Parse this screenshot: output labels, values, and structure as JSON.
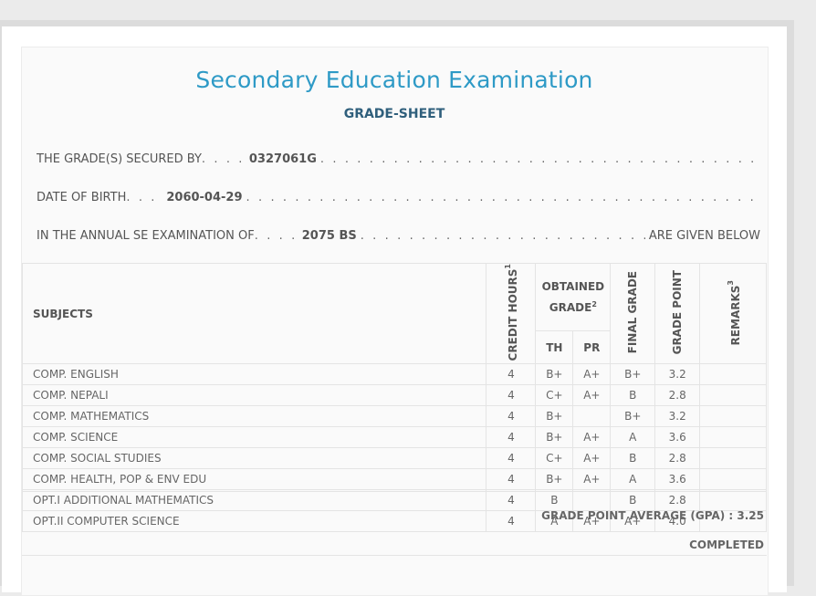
{
  "header": {
    "title": "Secondary Education Examination",
    "subtitle": "GRADE-SHEET"
  },
  "info": {
    "secured_label": "THE GRADE(S) SECURED BY",
    "secured_value": "0327061G",
    "dob_label": "DATE OF BIRTH",
    "dob_value": "2060-04-29",
    "exam_label": "IN THE ANNUAL SE EXAMINATION OF",
    "exam_value": "2075 BS",
    "exam_tail": "ARE GIVEN BELOW"
  },
  "table": {
    "col_subjects": "SUBJECTS",
    "col_credit": "CREDIT HOURS",
    "col_credit_sup": "1",
    "col_obtained": "OBTAINED GRADE",
    "col_obtained_sup": "2",
    "col_th": "TH",
    "col_pr": "PR",
    "col_final": "FINAL GRADE",
    "col_point": "GRADE POINT",
    "col_remarks": "REMARKS",
    "col_remarks_sup": "3",
    "rows": [
      {
        "subject": "COMP. ENGLISH",
        "credit": "4",
        "th": "B+",
        "pr": "A+",
        "final": "B+",
        "point": "3.2",
        "remarks": ""
      },
      {
        "subject": "COMP. NEPALI",
        "credit": "4",
        "th": "C+",
        "pr": "A+",
        "final": "B",
        "point": "2.8",
        "remarks": ""
      },
      {
        "subject": "COMP. MATHEMATICS",
        "credit": "4",
        "th": "B+",
        "pr": "",
        "final": "B+",
        "point": "3.2",
        "remarks": ""
      },
      {
        "subject": "COMP. SCIENCE",
        "credit": "4",
        "th": "B+",
        "pr": "A+",
        "final": "A",
        "point": "3.6",
        "remarks": ""
      },
      {
        "subject": "COMP. SOCIAL STUDIES",
        "credit": "4",
        "th": "C+",
        "pr": "A+",
        "final": "B",
        "point": "2.8",
        "remarks": ""
      },
      {
        "subject": "COMP. HEALTH, POP & ENV EDU",
        "credit": "4",
        "th": "B+",
        "pr": "A+",
        "final": "A",
        "point": "3.6",
        "remarks": ""
      },
      {
        "subject": "OPT.I ADDITIONAL MATHEMATICS",
        "credit": "4",
        "th": "B",
        "pr": "",
        "final": "B",
        "point": "2.8",
        "remarks": ""
      },
      {
        "subject": "OPT.II COMPUTER SCIENCE",
        "credit": "4",
        "th": "A",
        "pr": "A+",
        "final": "A+",
        "point": "4.0",
        "remarks": ""
      }
    ]
  },
  "summary": {
    "gpa_label": "GRADE POINT AVERAGE (GPA) :",
    "gpa_value": "3.25",
    "status": "COMPLETED"
  }
}
